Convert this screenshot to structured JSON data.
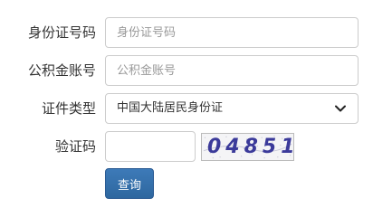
{
  "form": {
    "id_number": {
      "label": "身份证号码",
      "placeholder": "身份证号码",
      "value": ""
    },
    "fund_account": {
      "label": "公积金账号",
      "placeholder": "公积金账号",
      "value": ""
    },
    "id_type": {
      "label": "证件类型",
      "selected": "中国大陆居民身份证",
      "icon": "chevron-down-icon"
    },
    "captcha": {
      "label": "验证码",
      "value": "",
      "image_text": "04851"
    },
    "submit_label": "查询"
  },
  "colors": {
    "button_bg": "#3370AB",
    "border": "#CCCCCC",
    "label_text": "#333333",
    "placeholder_text": "#999999",
    "captcha_text": "#3B3A9A"
  }
}
